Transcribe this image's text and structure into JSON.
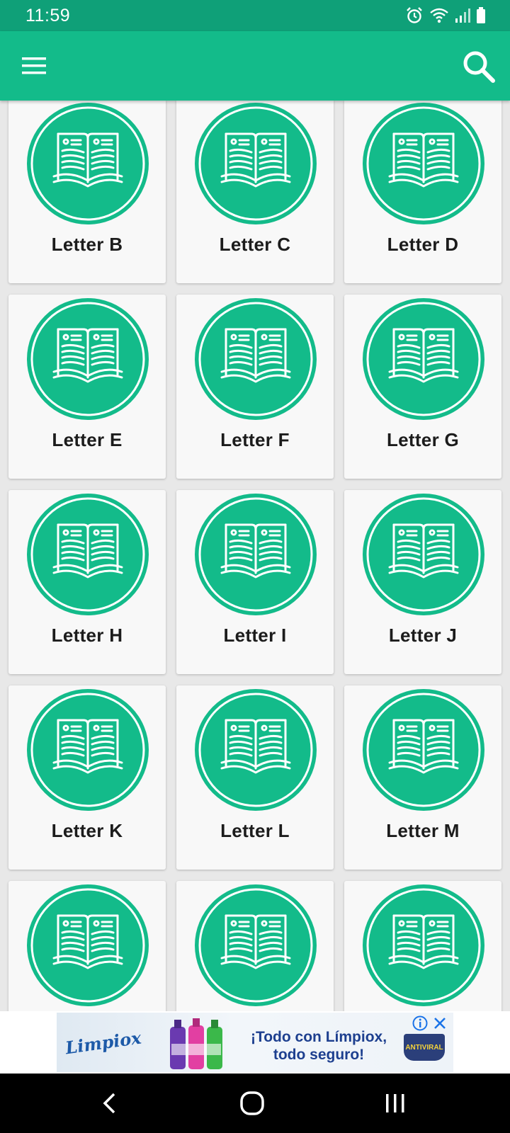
{
  "status_bar": {
    "time": "11:59",
    "icons": [
      "alarm-icon",
      "wifi-icon",
      "signal-icon",
      "battery-icon"
    ]
  },
  "app_bar": {
    "menu_icon": "hamburger-menu-icon",
    "search_icon": "search-icon",
    "color": "#13bb8a"
  },
  "grid": {
    "items": [
      {
        "label": "Letter B"
      },
      {
        "label": "Letter C"
      },
      {
        "label": "Letter D"
      },
      {
        "label": "Letter E"
      },
      {
        "label": "Letter F"
      },
      {
        "label": "Letter G"
      },
      {
        "label": "Letter H"
      },
      {
        "label": "Letter I"
      },
      {
        "label": "Letter J"
      },
      {
        "label": "Letter K"
      },
      {
        "label": "Letter L"
      },
      {
        "label": "Letter M"
      },
      {
        "label": ""
      },
      {
        "label": ""
      },
      {
        "label": ""
      }
    ],
    "item_icon": "open-book-icon"
  },
  "ad": {
    "brand": "Limpiox",
    "headline_line1": "¡Todo con Límpiox,",
    "headline_line2": "todo seguro!",
    "badge": "ANTIVIRAL",
    "info_icon": "ad-info-icon",
    "close_icon": "ad-close-icon"
  },
  "nav_bar": {
    "back_icon": "back-icon",
    "home_icon": "home-icon",
    "recents_icon": "recents-icon"
  }
}
